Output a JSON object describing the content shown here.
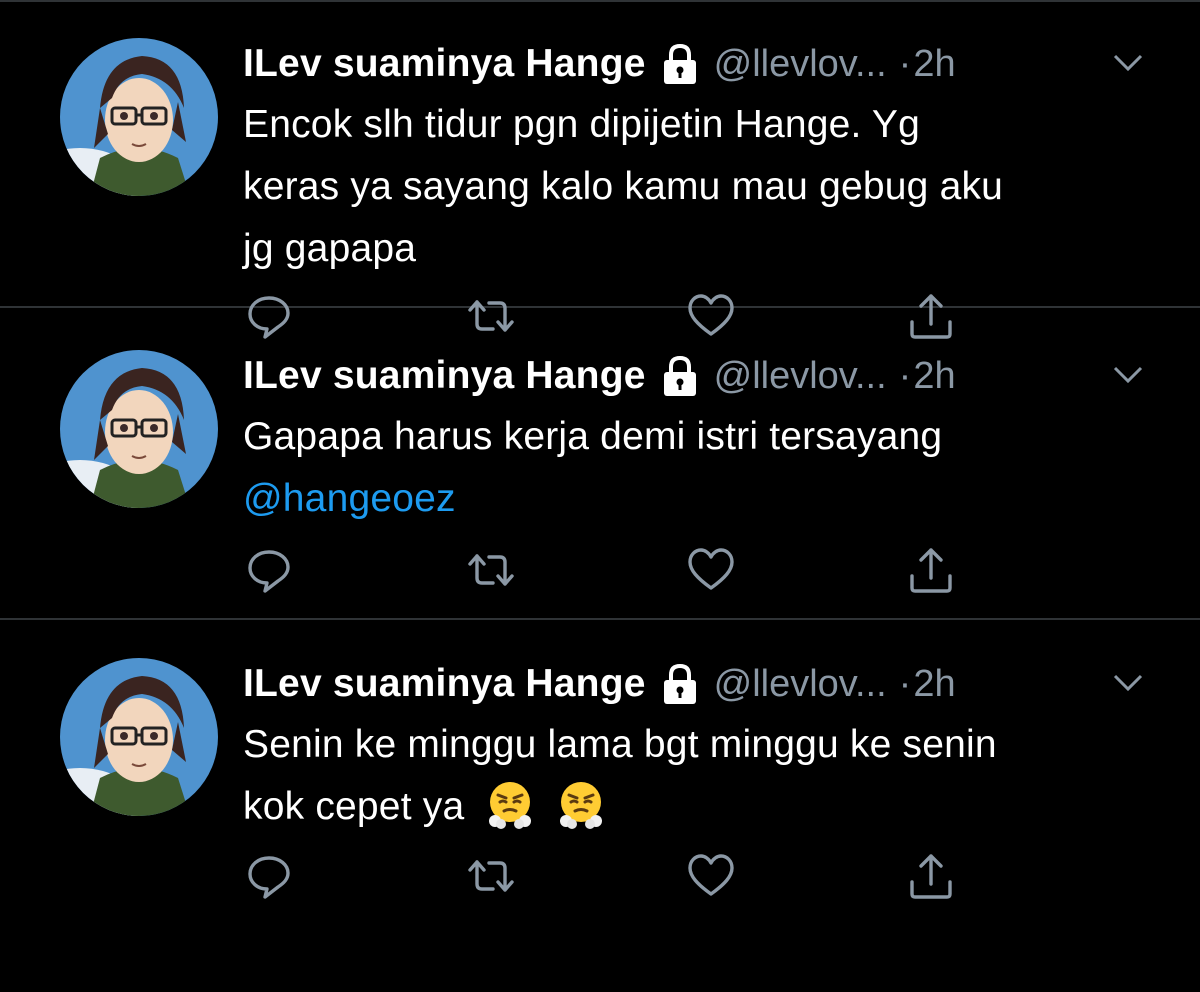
{
  "colors": {
    "background": "#000000",
    "divider": "#2f3336",
    "primary_text": "#ffffff",
    "secondary_text": "#8b98a5",
    "link": "#1d9bf0"
  },
  "tweets": [
    {
      "display_name": "ILev suaminya Hange",
      "handle": "@llevlov...",
      "separator": "·",
      "time": "2h",
      "text": "Gapapa harus kerja demi istri tersayang",
      "mention": "@hangeoez",
      "emojis": []
    },
    {
      "display_name": "ILev suaminya Hange",
      "handle": "@llevlov...",
      "separator": "·",
      "time": "2h",
      "text_line1": "Senin ke minggu lama bgt minggu ke senin",
      "text_line2": "kok cepet ya",
      "emojis": [
        "face-with-steam-from-nose",
        "face-with-steam-from-nose"
      ]
    },
    {
      "display_name": "ILev suaminya Hange",
      "handle": "@llevlov...",
      "separator": "·",
      "time": "2h",
      "text_line1": "Encok slh tidur pgn dipijetin Hange. Yg",
      "text_line2": "keras ya sayang kalo kamu mau gebug aku",
      "text_line3": "jg gapapa",
      "emojis": []
    }
  ],
  "icons": {
    "protected": "lock-icon",
    "menu": "chevron-down-icon",
    "reply": "reply-icon",
    "retweet": "retweet-icon",
    "like": "heart-icon",
    "share": "share-icon"
  }
}
